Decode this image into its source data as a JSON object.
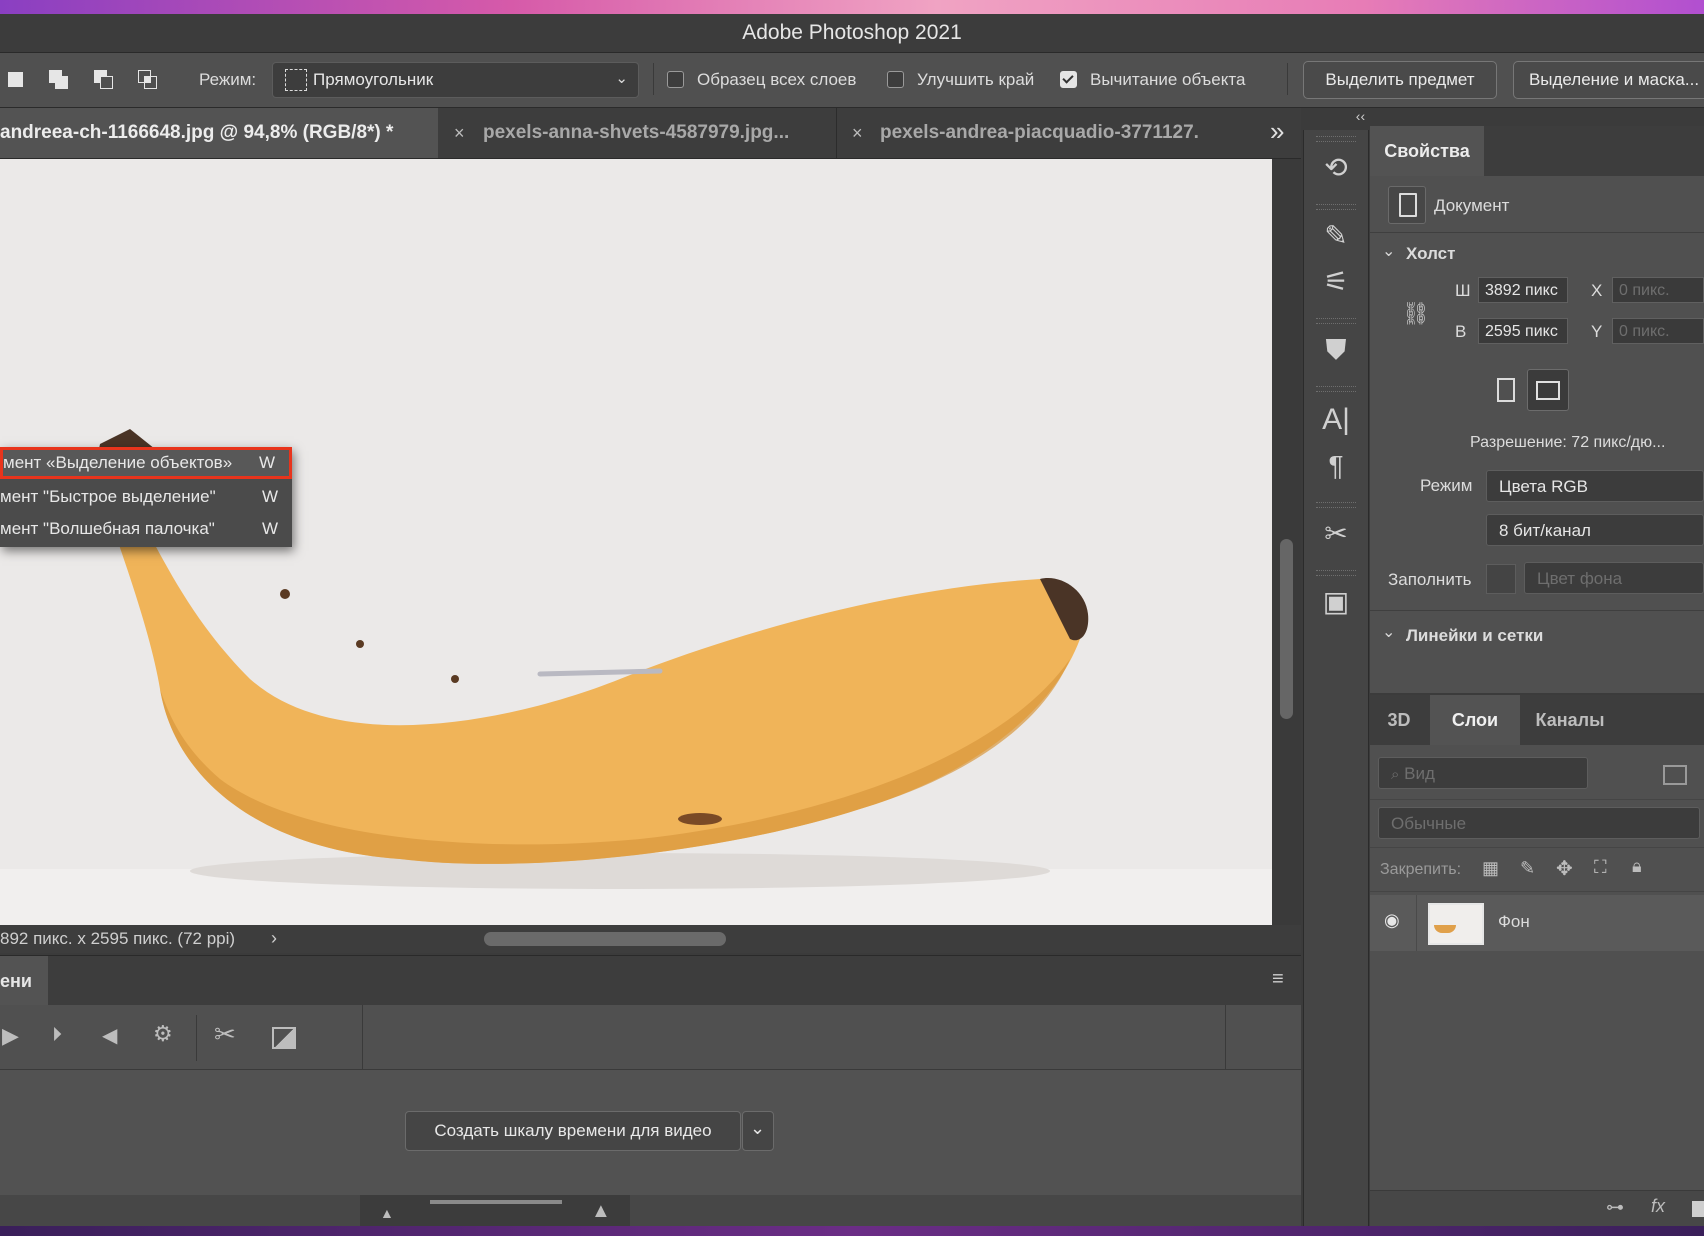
{
  "app": {
    "title": "Adobe Photoshop 2021"
  },
  "options_bar": {
    "mode_label": "Режим:",
    "mode_value": "Прямоугольник",
    "sample_all_layers": {
      "label": "Образец всех слоев",
      "checked": false
    },
    "enhance_edge": {
      "label": "Улучшить край",
      "checked": false
    },
    "object_subtract": {
      "label": "Вычитание объекта",
      "checked": true
    },
    "select_subject_button": "Выделить предмет",
    "select_and_mask_button": "Выделение и маска..."
  },
  "tabs": [
    {
      "label": "andreea-ch-1166648.jpg @ 94,8% (RGB/8*) *",
      "active": true
    },
    {
      "label": "pexels-anna-shvets-4587979.jpg...",
      "active": false
    },
    {
      "label": "pexels-andrea-piacquadio-3771127.",
      "active": false
    }
  ],
  "tool_flyout": [
    {
      "label": "мент «Выделение объектов»",
      "shortcut": "W",
      "highlighted": true
    },
    {
      "label": "мент \"Быстрое выделение\"",
      "shortcut": "W",
      "highlighted": false
    },
    {
      "label": "мент \"Волшебная палочка\"",
      "shortcut": "W",
      "highlighted": false
    }
  ],
  "status": {
    "text": "892 пикс. x 2595 пикс. (72 ppi)"
  },
  "timeline": {
    "tab_label": "ени",
    "create_button": "Создать шкалу времени для видео"
  },
  "properties": {
    "tab_label": "Свойства",
    "document_label": "Документ",
    "canvas_section": "Холст",
    "width_label": "Ш",
    "width_value": "3892 пикс",
    "height_label": "В",
    "height_value": "2595 пикс",
    "x_label": "X",
    "x_placeholder": "0 пикс.",
    "y_label": "Y",
    "y_placeholder": "0 пикс.",
    "resolution": "Разрешение: 72 пикс/дю...",
    "mode_label": "Режим",
    "mode_value": "Цвета RGB",
    "bit_depth": "8 бит/канал",
    "fill_label": "Заполнить",
    "fill_value": "Цвет фона",
    "rulers_section": "Линейки и сетки"
  },
  "layers_panel": {
    "tabs": [
      {
        "label": "3D",
        "active": false
      },
      {
        "label": "Слои",
        "active": true
      },
      {
        "label": "Каналы",
        "active": false
      }
    ],
    "filter_placeholder": "Вид",
    "blend_mode": "Обычные",
    "lock_label": "Закрепить:",
    "layers": [
      {
        "name": "Фон",
        "visible": true
      }
    ]
  },
  "colors": {
    "highlight_border": "#e8341c",
    "panel_bg": "#505050",
    "banana": "#f0b459"
  },
  "icons": [
    "history-icon",
    "brush-settings-icon",
    "adjustments-icon",
    "clone-source-icon",
    "character-icon",
    "paragraph-icon",
    "tools-icon",
    "glyphs-icon",
    "eye-icon",
    "link-icon",
    "fx-icon",
    "scissors-icon",
    "gear-icon"
  ]
}
